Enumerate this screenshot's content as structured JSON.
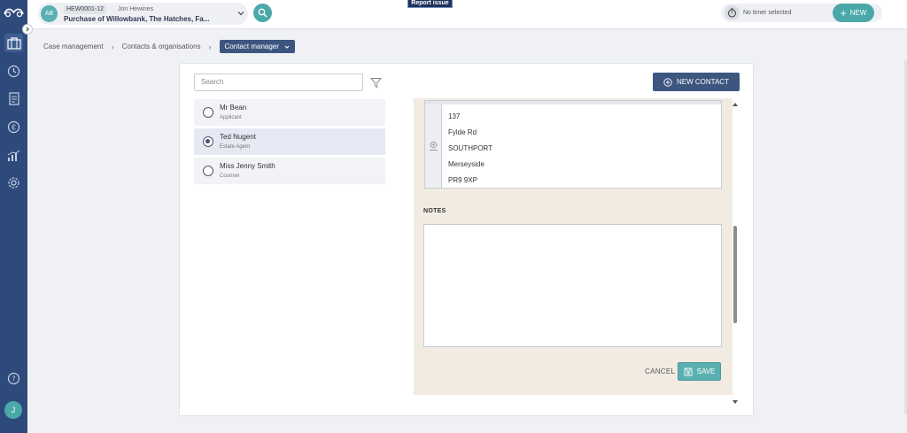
{
  "sidebar": {
    "icons": [
      "logo-icon",
      "cases-icon",
      "clock-icon",
      "documents-icon",
      "currency-icon",
      "reports-icon",
      "settings-icon",
      "help-icon"
    ],
    "user_initial": "J",
    "accent": "#2e4a7a"
  },
  "header": {
    "matter_initials": "AB",
    "matter_code": "HEW0001-12",
    "matter_user": "Jon Hewines",
    "matter_title": "Purchase of Willowbank, The Hatches, Fa...",
    "report_issue": "Report issue",
    "timer_text": "No timer selected",
    "new_label": "NEW"
  },
  "breadcrumb": {
    "items": [
      "Case management",
      "Contacts & organisations"
    ],
    "current": "Contact manager"
  },
  "search": {
    "placeholder": "Search"
  },
  "contacts": [
    {
      "name": "Mr Bean",
      "role": "Applicant",
      "selected": false
    },
    {
      "name": "Ted Nugent",
      "role": "Estate Agent",
      "selected": true
    },
    {
      "name": "Miss Jenny Smith",
      "role": "Counsel",
      "selected": false
    }
  ],
  "new_contact_label": "NEW CONTACT",
  "address": {
    "lines": [
      "137",
      "Fylde Rd",
      "SOUTHPORT",
      "Merseyside",
      "PR9 9XP"
    ]
  },
  "notes": {
    "label": "NOTES",
    "value": ""
  },
  "actions": {
    "cancel": "CANCEL",
    "save": "SAVE"
  },
  "colors": {
    "teal": "#4aa8a8",
    "navy": "#3d5680",
    "panel": "#f1ebe2"
  }
}
